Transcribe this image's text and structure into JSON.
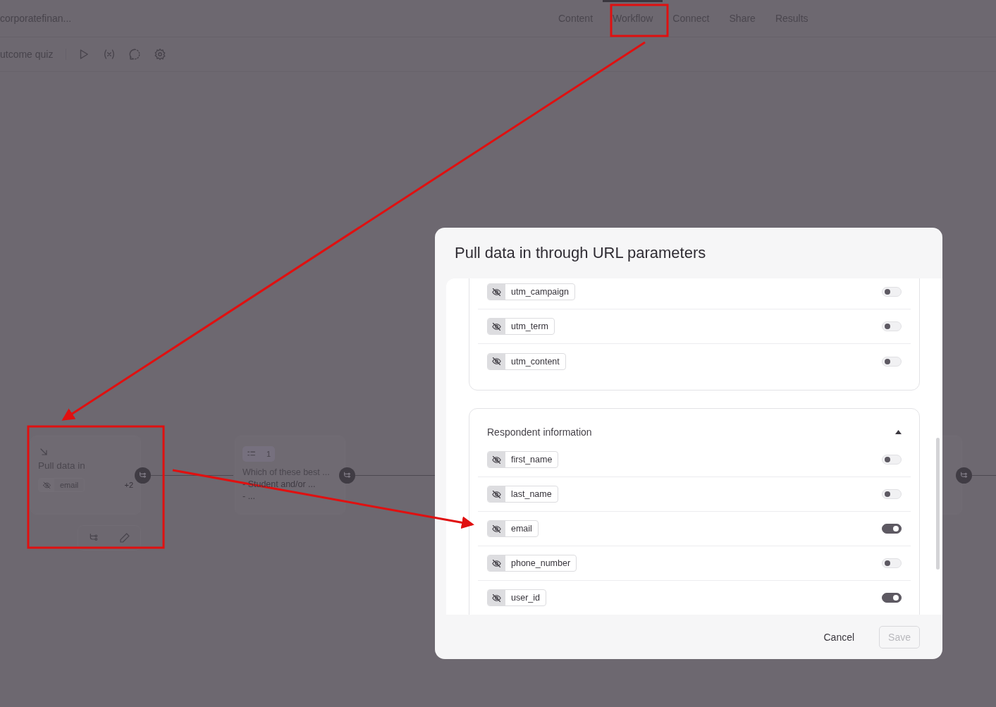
{
  "header": {
    "title": "corporatefinan...",
    "tabs": [
      {
        "label": "Content",
        "selected": false
      },
      {
        "label": "Workflow",
        "selected": true
      },
      {
        "label": "Connect",
        "selected": false
      },
      {
        "label": "Share",
        "selected": false
      },
      {
        "label": "Results",
        "selected": false
      }
    ]
  },
  "toolbar": {
    "title": "utcome quiz"
  },
  "canvas": {
    "nodes": [
      {
        "kind": "pull",
        "title": "Pull data in",
        "chip": "email",
        "more": "+2"
      },
      {
        "kind": "question",
        "badge": "1",
        "title": "Which of these best ...",
        "lines": [
          "- Student and/or ...",
          "- ..."
        ]
      },
      {
        "kind": "hidden"
      }
    ]
  },
  "modal": {
    "title": "Pull data in through URL parameters",
    "groups": [
      {
        "params": [
          {
            "name": "utm_campaign",
            "on": false
          },
          {
            "name": "utm_term",
            "on": false
          },
          {
            "name": "utm_content",
            "on": false
          }
        ]
      },
      {
        "heading": "Respondent information",
        "expanded": true,
        "params": [
          {
            "name": "first_name",
            "on": false
          },
          {
            "name": "last_name",
            "on": false
          },
          {
            "name": "email",
            "on": true
          },
          {
            "name": "phone_number",
            "on": false
          },
          {
            "name": "user_id",
            "on": true
          }
        ]
      }
    ],
    "buttons": [
      {
        "label": "Cancel",
        "kind": "text",
        "disabled": false
      },
      {
        "label": "Save",
        "kind": "outline",
        "disabled": true
      }
    ]
  }
}
